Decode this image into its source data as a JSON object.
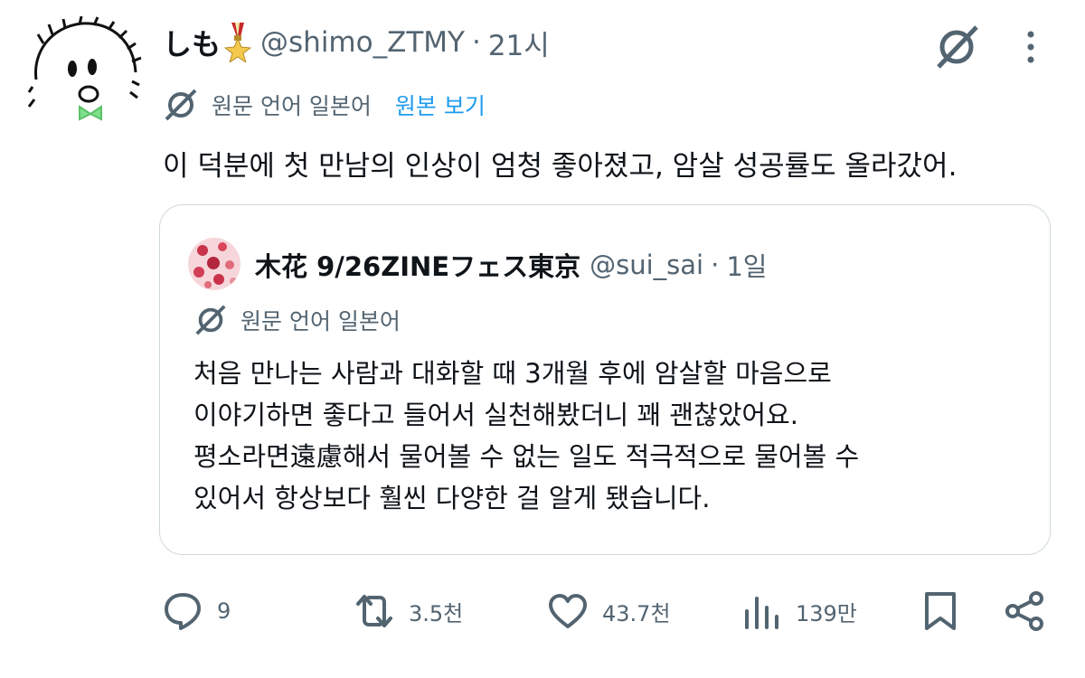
{
  "tweet": {
    "display_name": "しも",
    "handle": "@shimo_ZTMY",
    "separator": "·",
    "time": "21시",
    "translation": {
      "source_lang_label": "원문 언어 일본어",
      "view_original_label": "원본 보기"
    },
    "text": "이 덕분에 첫 만남의 인상이 엄청 좋아졌고, 암살 성공률도 올라갔어."
  },
  "quoted_tweet": {
    "display_name": "木花 9/26ZINEフェス東京",
    "handle": "@sui_sai",
    "separator": "·",
    "time": "1일",
    "source_lang_label": "원문 언어 일본어",
    "text": "처음 만나는 사람과 대화할 때 3개월 후에 암살할 마음으로\n이야기하면 좋다고 들어서 실천해봤더니 꽤 괜찮았어요.\n평소라면遠慮해서 물어볼 수 없는 일도 적극적으로 물어볼 수\n있어서 항상보다 훨씬 다양한 걸 알게 됐습니다."
  },
  "actions": {
    "replies": "9",
    "retweets": "3.5천",
    "likes": "43.7천",
    "views": "139만"
  },
  "icons": {
    "grok": "grok-icon",
    "more": "more-icon",
    "translate": "translate-icon",
    "reply": "reply-icon",
    "retweet": "retweet-icon",
    "like": "heart-icon",
    "views": "views-icon",
    "bookmark": "bookmark-icon",
    "share": "share-icon",
    "medal": "medal-icon"
  },
  "colors": {
    "accent": "#1d9bf0",
    "text": "#0f1419",
    "muted": "#536471",
    "border": "#cfd9de"
  }
}
